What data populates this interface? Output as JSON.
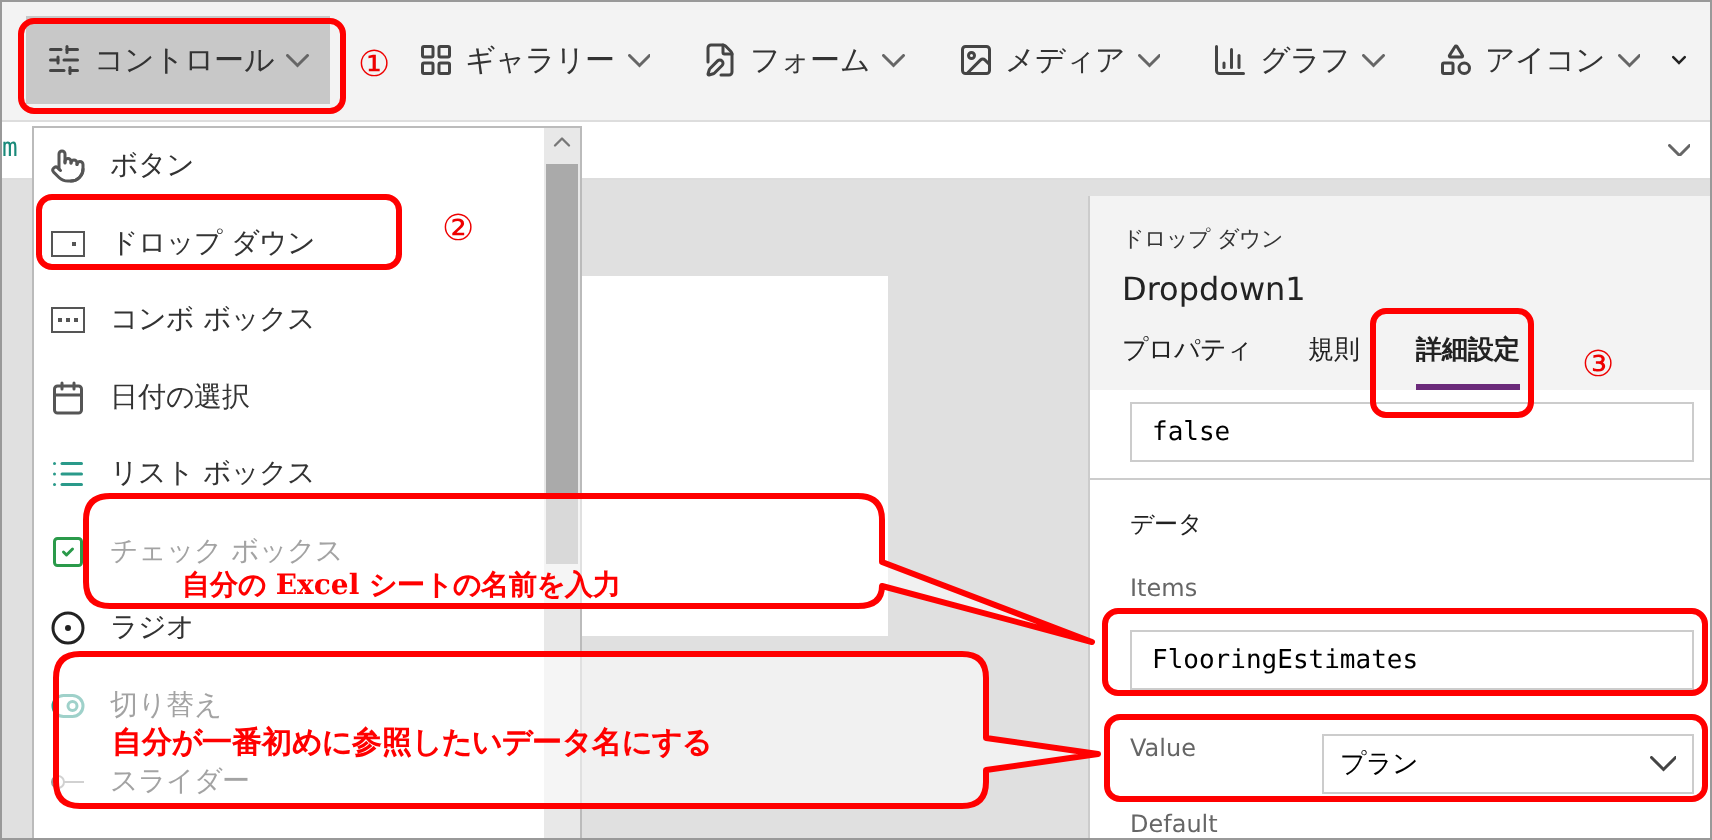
{
  "toolbar": {
    "items": [
      {
        "label": "コントロール",
        "kind": "controls",
        "selected": true
      },
      {
        "label": "ギャラリー",
        "kind": "gallery",
        "selected": false
      },
      {
        "label": "フォーム",
        "kind": "form",
        "selected": false
      },
      {
        "label": "メディア",
        "kind": "media",
        "selected": false
      },
      {
        "label": "グラフ",
        "kind": "chart",
        "selected": false
      },
      {
        "label": "アイコン",
        "kind": "icons",
        "selected": false
      }
    ]
  },
  "formula_bar": {
    "text": "m"
  },
  "controls_menu": {
    "items": [
      {
        "label": "ボタン",
        "kind": "button"
      },
      {
        "label": "ドロップ ダウン",
        "kind": "dropdown"
      },
      {
        "label": "コンボ ボックス",
        "kind": "combo"
      },
      {
        "label": "日付の選択",
        "kind": "date"
      },
      {
        "label": "リスト ボックス",
        "kind": "list"
      },
      {
        "label": "チェック ボックス",
        "kind": "checkbox"
      },
      {
        "label": "ラジオ",
        "kind": "radio"
      },
      {
        "label": "切り替え",
        "kind": "toggle"
      },
      {
        "label": "スライダー",
        "kind": "slider"
      }
    ]
  },
  "properties_panel": {
    "control_type": "ドロップ ダウン",
    "control_name": "Dropdown1",
    "tabs": [
      {
        "label": "プロパティ",
        "selected": false
      },
      {
        "label": "規則",
        "selected": false
      },
      {
        "label": "詳細設定",
        "selected": true
      }
    ],
    "top_field": {
      "value": "false"
    },
    "section": "データ",
    "items_label": "Items",
    "items_field": {
      "value": "FlooringEstimates"
    },
    "value_label": "Value",
    "value_select": {
      "value": "プラン"
    },
    "default_label": "Default"
  },
  "annotations": {
    "markers": [
      "①",
      "②",
      "③"
    ],
    "callouts": [
      "自分の Excel シートの名前を入力",
      "自分が一番初めに参照したいデータ名にする"
    ]
  }
}
